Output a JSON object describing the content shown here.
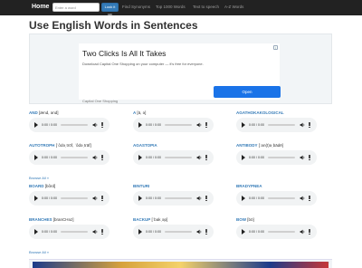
{
  "nav": {
    "home": "Home",
    "search_placeholder": "Enter a word",
    "search_button": "Look it up",
    "links": [
      "Find Synonyms",
      "Top 1000 Words",
      "Text to speech",
      "A-Z Words"
    ]
  },
  "title": "Use English Words in Sentences",
  "ad": {
    "headline": "Two Clicks Is All It Takes",
    "body": "Download Capital One Shopping on your computer — it's free for everyone.",
    "sponsor": "Capital One Shopping",
    "button": "Open",
    "adchoice": "i"
  },
  "player": {
    "time": "0:00 / 0:00"
  },
  "words": [
    {
      "word": "AND",
      "phonetic": "[ænd, ənd]"
    },
    {
      "word": "A",
      "phonetic": "[ā, ə]"
    },
    {
      "word": "AGATHOKAKOLOGICAL",
      "phonetic": ""
    },
    {
      "word": "AUTOTROPH",
      "phonetic": "[ˈôdəˌtrōf, ˈôdəˌträf]"
    },
    {
      "word": "AGASTOPIA",
      "phonetic": ""
    },
    {
      "word": "ANTIBODY",
      "phonetic": "[ˈan(t)əˌbädē]"
    },
    {
      "word": "BOARD",
      "phonetic": "[bôrd]"
    },
    {
      "word": "BINTURI",
      "phonetic": ""
    },
    {
      "word": "BRADYPNEA",
      "phonetic": ""
    },
    {
      "word": "BRANCHES",
      "phonetic": "[branCHəz]"
    },
    {
      "word": "BACKUP",
      "phonetic": "[ˈbakˌəp]"
    },
    {
      "word": "BOW",
      "phonetic": "[bō]"
    }
  ],
  "browse_all": "Browse All »",
  "colors": {
    "navbar": "#222222",
    "link": "#337ab7",
    "ad_button": "#1a73e8"
  },
  "icons": {
    "play": "play-icon",
    "volume": "volume-icon",
    "menu": "more-vert-icon"
  }
}
